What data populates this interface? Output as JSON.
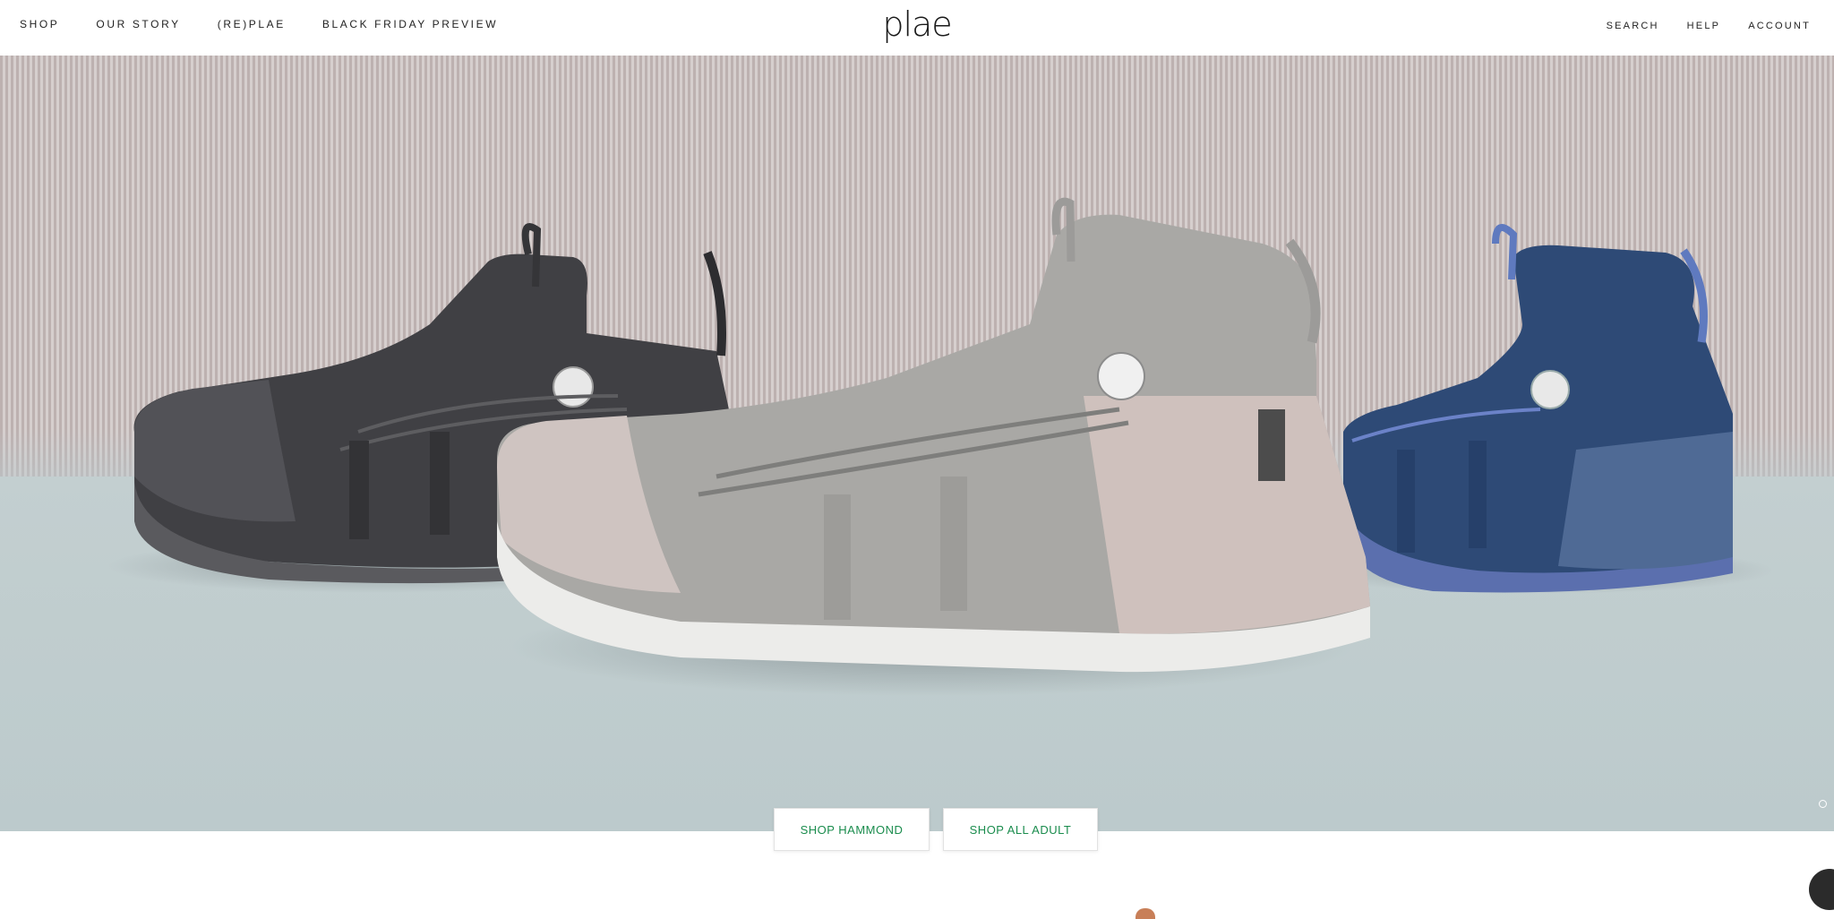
{
  "header": {
    "logo_text": "plae",
    "nav_left": [
      "SHOP",
      "OUR STORY",
      "(RE)PLAE",
      "BLACK FRIDAY PREVIEW"
    ],
    "nav_right": [
      "SEARCH",
      "HELP",
      "ACCOUNT"
    ]
  },
  "hero": {
    "image_description_icon": "three-hammond-sneakers-image",
    "shoe_colors": [
      "#4a4a4d",
      "#b8b8b4",
      "#2f4c78"
    ],
    "buttons": [
      "SHOP HAMMOND",
      "SHOP ALL ADULT"
    ],
    "slider_position": 1,
    "slider_count": 1
  },
  "colors": {
    "accent_green": "#1a8c4d"
  }
}
